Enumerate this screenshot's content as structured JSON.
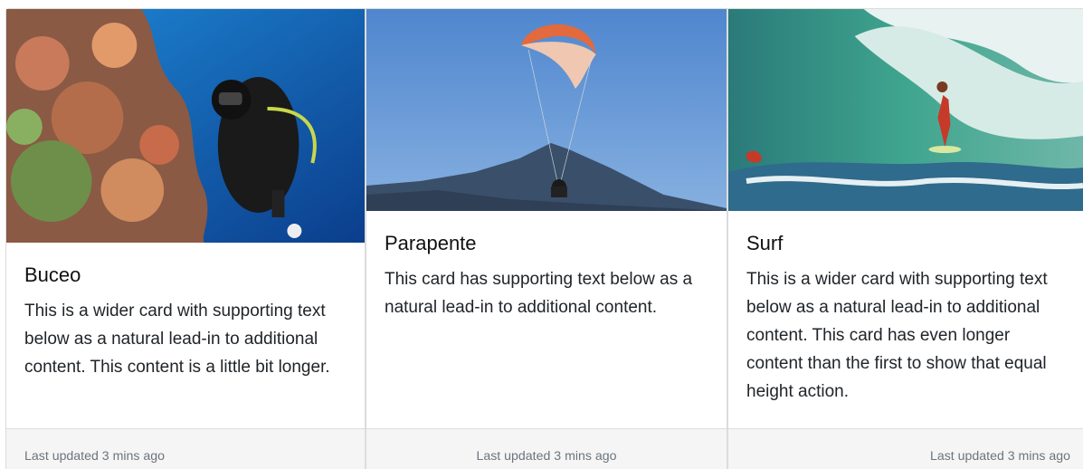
{
  "cards": [
    {
      "title": "Buceo",
      "text": "This is a wider card with supporting text below as a natural lead-in to additional content. This content is a little bit longer.",
      "footer": "Last updated 3 mins ago",
      "image_icon": "scuba-diver-photo"
    },
    {
      "title": "Parapente",
      "text": "This card has supporting text below as a natural lead-in to additional content.",
      "footer": "Last updated 3 mins ago",
      "image_icon": "paraglider-photo"
    },
    {
      "title": "Surf",
      "text": "This is a wider card with supporting text below as a natural lead-in to additional content. This card has even longer content than the first to show that equal height action.",
      "footer": "Last updated 3 mins ago",
      "image_icon": "surfer-photo"
    }
  ],
  "colors": {
    "footer_bg": "#f5f5f5",
    "border": "#dcdcdc",
    "muted_text": "#6c757d"
  }
}
